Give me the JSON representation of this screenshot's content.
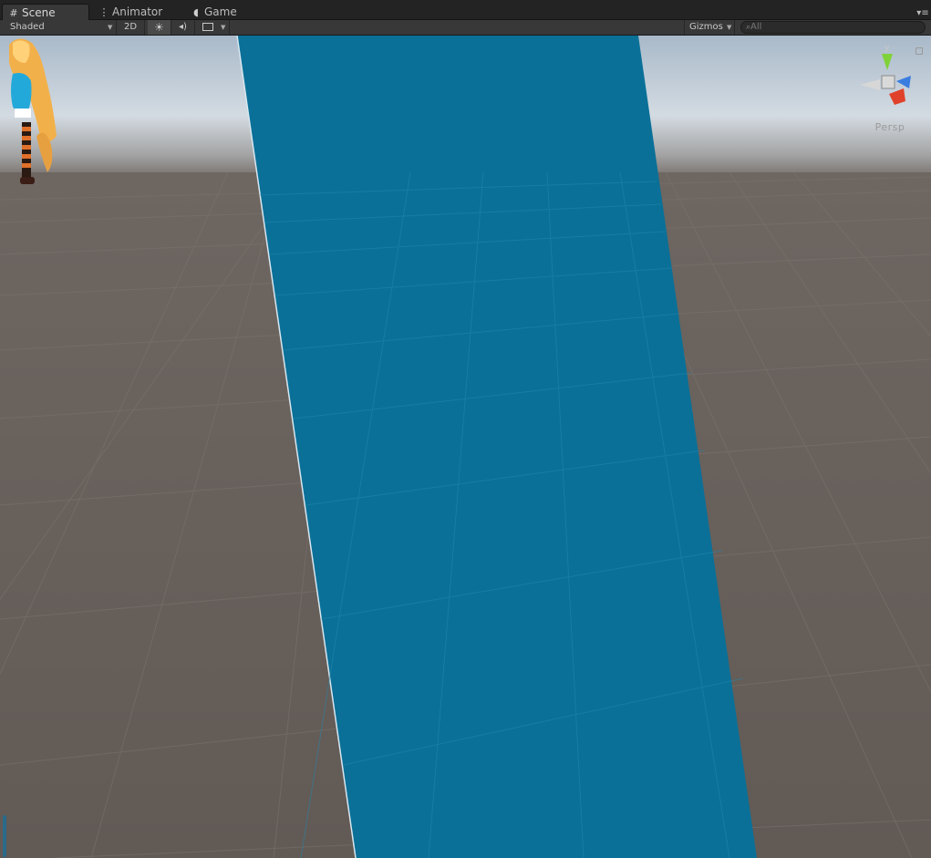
{
  "tabs": [
    {
      "label": "Scene",
      "icon": "grid-icon",
      "active": true
    },
    {
      "label": "Animator",
      "icon": "animator-icon",
      "active": false
    },
    {
      "label": "Game",
      "icon": "pacman-icon",
      "active": false
    }
  ],
  "toolbar": {
    "draw_mode": "Shaded",
    "mode_2d": "2D",
    "lighting_icon": "sun-icon",
    "audio_icon": "speaker-icon",
    "effects_icon": "image-icon",
    "gizmos_label": "Gizmos",
    "search_placeholder": "All"
  },
  "scene": {
    "gizmo_axis_label": "y",
    "projection_label": "Persp",
    "plane_color": "#0a7098",
    "ground_color": "#645c56",
    "sky_color": "#c5d0da"
  }
}
